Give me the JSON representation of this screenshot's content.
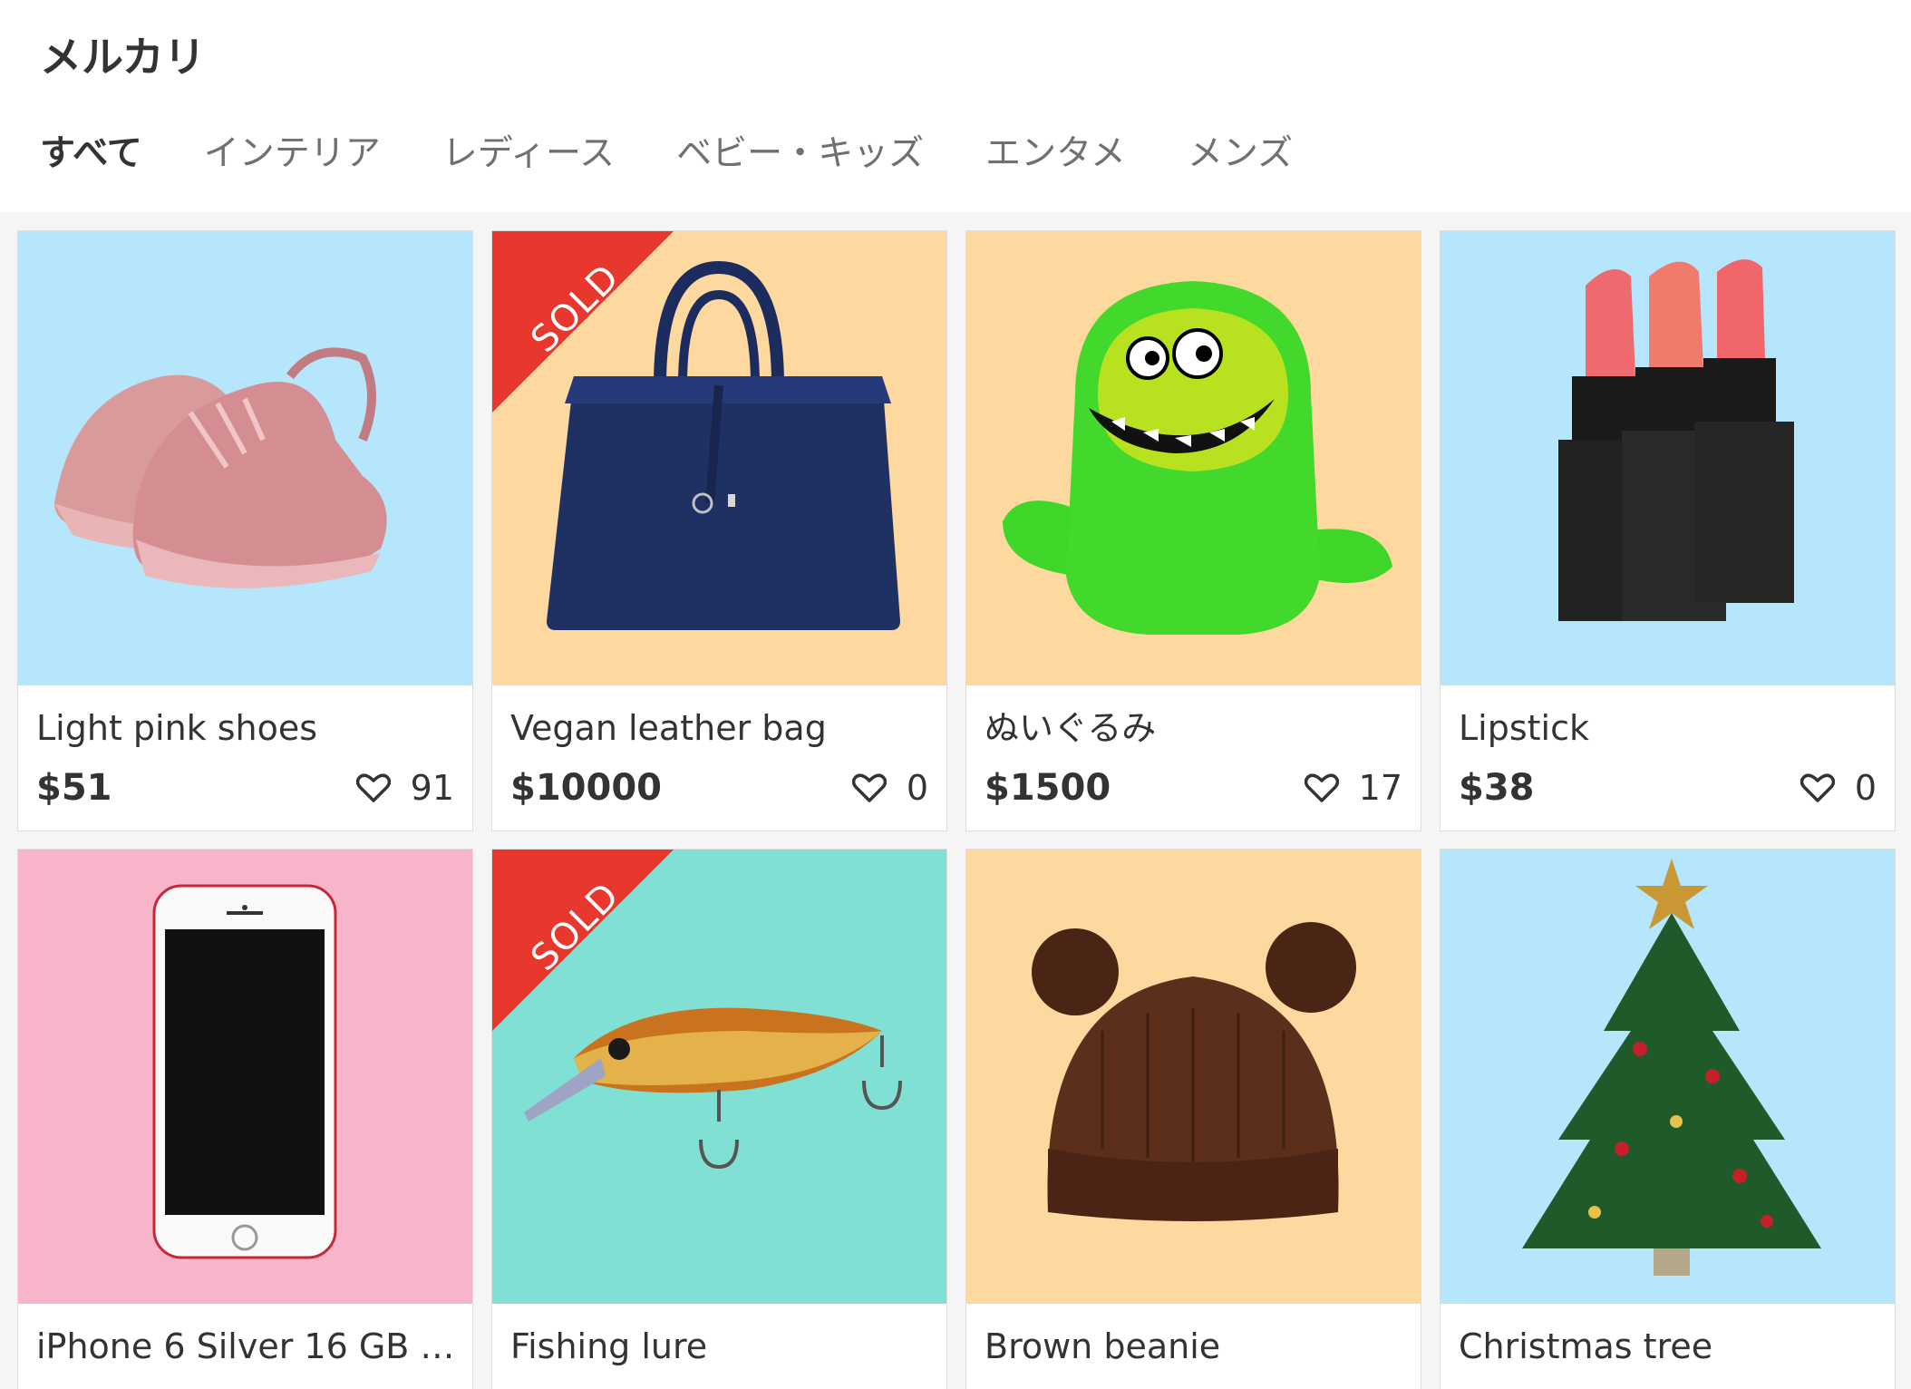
{
  "header": {
    "title": "メルカリ",
    "tabs": [
      {
        "label": "すべて",
        "active": true
      },
      {
        "label": "インテリア",
        "active": false
      },
      {
        "label": "レディース",
        "active": false
      },
      {
        "label": "ベビー・キッズ",
        "active": false
      },
      {
        "label": "エンタメ",
        "active": false
      },
      {
        "label": "メンズ",
        "active": false
      }
    ]
  },
  "items": [
    {
      "name": "Light pink shoes",
      "price": "$51",
      "likes": "91",
      "sold": false,
      "bg": "#b5e6fb",
      "icon": "pink-sneakers"
    },
    {
      "name": "Vegan leather bag",
      "price": "$10000",
      "likes": "0",
      "sold": true,
      "sold_label": "SOLD",
      "bg": "#fdd89f",
      "icon": "navy-handbag"
    },
    {
      "name": "ぬいぐるみ",
      "price": "$1500",
      "likes": "17",
      "sold": false,
      "bg": "#fdd89f",
      "icon": "green-plush-monster"
    },
    {
      "name": "Lipstick",
      "price": "$38",
      "likes": "0",
      "sold": false,
      "bg": "#b5e6fb",
      "icon": "lipsticks"
    },
    {
      "name": "iPhone 6 Silver 16 GB …",
      "price": "",
      "likes": "",
      "sold": false,
      "bg": "#f8b4c8",
      "icon": "smartphone"
    },
    {
      "name": "Fishing lure",
      "price": "",
      "likes": "",
      "sold": true,
      "sold_label": "SOLD",
      "bg": "#80e0d4",
      "icon": "fishing-lure"
    },
    {
      "name": "Brown beanie",
      "price": "",
      "likes": "",
      "sold": false,
      "bg": "#fdd89f",
      "icon": "brown-beanie"
    },
    {
      "name": "Christmas tree",
      "price": "",
      "likes": "",
      "sold": false,
      "bg": "#b5e6fb",
      "icon": "christmas-tree"
    }
  ],
  "colors": {
    "sold_ribbon": "#e8382e",
    "header_bg": "#ffffff",
    "page_bg": "#f5f5f5"
  }
}
